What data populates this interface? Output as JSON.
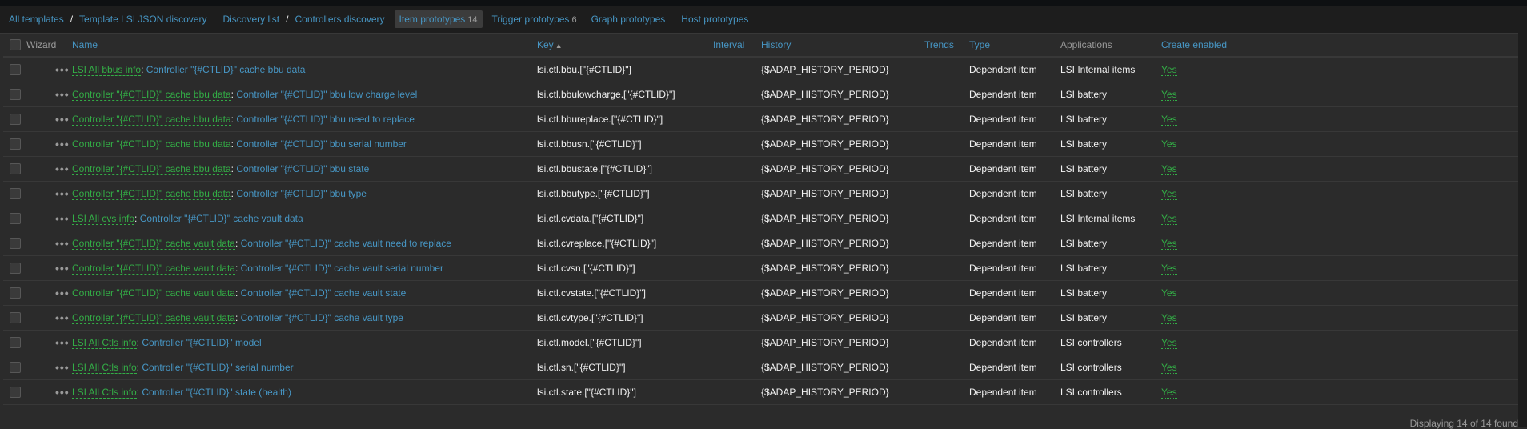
{
  "breadcrumb": {
    "all_templates": "All templates",
    "template": "Template LSI JSON discovery",
    "discovery_list": "Discovery list",
    "discovery_rule": "Controllers discovery"
  },
  "tabs": [
    {
      "label": "Item prototypes",
      "count": "14",
      "active": true
    },
    {
      "label": "Trigger prototypes",
      "count": "6",
      "active": false
    },
    {
      "label": "Graph prototypes",
      "count": "",
      "active": false
    },
    {
      "label": "Host prototypes",
      "count": "",
      "active": false
    }
  ],
  "table": {
    "headers": {
      "wizard": "Wizard",
      "name": "Name",
      "key": "Key",
      "interval": "Interval",
      "history": "History",
      "trends": "Trends",
      "type": "Type",
      "applications": "Applications",
      "create_enabled": "Create enabled"
    },
    "sort_indicator": "▲",
    "rows": [
      {
        "master": "LSI All bbus info",
        "name": "Controller \"{#CTLID}\" cache bbu data",
        "key": "lsi.ctl.bbu.[\"{#CTLID}\"]",
        "interval": "",
        "history": "{$ADAP_HISTORY_PERIOD}",
        "trends": "",
        "type": "Dependent item",
        "app": "LSI Internal items",
        "enabled": "Yes"
      },
      {
        "master": "Controller \"{#CTLID}\" cache bbu data",
        "name": "Controller \"{#CTLID}\" bbu low charge level",
        "key": "lsi.ctl.bbulowcharge.[\"{#CTLID}\"]",
        "interval": "",
        "history": "{$ADAP_HISTORY_PERIOD}",
        "trends": "",
        "type": "Dependent item",
        "app": "LSI battery",
        "enabled": "Yes"
      },
      {
        "master": "Controller \"{#CTLID}\" cache bbu data",
        "name": "Controller \"{#CTLID}\" bbu need to replace",
        "key": "lsi.ctl.bbureplace.[\"{#CTLID}\"]",
        "interval": "",
        "history": "{$ADAP_HISTORY_PERIOD}",
        "trends": "",
        "type": "Dependent item",
        "app": "LSI battery",
        "enabled": "Yes"
      },
      {
        "master": "Controller \"{#CTLID}\" cache bbu data",
        "name": "Controller \"{#CTLID}\" bbu serial number",
        "key": "lsi.ctl.bbusn.[\"{#CTLID}\"]",
        "interval": "",
        "history": "{$ADAP_HISTORY_PERIOD}",
        "trends": "",
        "type": "Dependent item",
        "app": "LSI battery",
        "enabled": "Yes"
      },
      {
        "master": "Controller \"{#CTLID}\" cache bbu data",
        "name": "Controller \"{#CTLID}\" bbu state",
        "key": "lsi.ctl.bbustate.[\"{#CTLID}\"]",
        "interval": "",
        "history": "{$ADAP_HISTORY_PERIOD}",
        "trends": "",
        "type": "Dependent item",
        "app": "LSI battery",
        "enabled": "Yes"
      },
      {
        "master": "Controller \"{#CTLID}\" cache bbu data",
        "name": "Controller \"{#CTLID}\" bbu type",
        "key": "lsi.ctl.bbutype.[\"{#CTLID}\"]",
        "interval": "",
        "history": "{$ADAP_HISTORY_PERIOD}",
        "trends": "",
        "type": "Dependent item",
        "app": "LSI battery",
        "enabled": "Yes"
      },
      {
        "master": "LSI All cvs info",
        "name": "Controller \"{#CTLID}\" cache vault data",
        "key": "lsi.ctl.cvdata.[\"{#CTLID}\"]",
        "interval": "",
        "history": "{$ADAP_HISTORY_PERIOD}",
        "trends": "",
        "type": "Dependent item",
        "app": "LSI Internal items",
        "enabled": "Yes"
      },
      {
        "master": "Controller \"{#CTLID}\" cache vault data",
        "name": "Controller \"{#CTLID}\" cache vault need to replace",
        "key": "lsi.ctl.cvreplace.[\"{#CTLID}\"]",
        "interval": "",
        "history": "{$ADAP_HISTORY_PERIOD}",
        "trends": "",
        "type": "Dependent item",
        "app": "LSI battery",
        "enabled": "Yes"
      },
      {
        "master": "Controller \"{#CTLID}\" cache vault data",
        "name": "Controller \"{#CTLID}\" cache vault serial number",
        "key": "lsi.ctl.cvsn.[\"{#CTLID}\"]",
        "interval": "",
        "history": "{$ADAP_HISTORY_PERIOD}",
        "trends": "",
        "type": "Dependent item",
        "app": "LSI battery",
        "enabled": "Yes"
      },
      {
        "master": "Controller \"{#CTLID}\" cache vault data",
        "name": "Controller \"{#CTLID}\" cache vault state",
        "key": "lsi.ctl.cvstate.[\"{#CTLID}\"]",
        "interval": "",
        "history": "{$ADAP_HISTORY_PERIOD}",
        "trends": "",
        "type": "Dependent item",
        "app": "LSI battery",
        "enabled": "Yes"
      },
      {
        "master": "Controller \"{#CTLID}\" cache vault data",
        "name": "Controller \"{#CTLID}\" cache vault type",
        "key": "lsi.ctl.cvtype.[\"{#CTLID}\"]",
        "interval": "",
        "history": "{$ADAP_HISTORY_PERIOD}",
        "trends": "",
        "type": "Dependent item",
        "app": "LSI battery",
        "enabled": "Yes"
      },
      {
        "master": "LSI All Ctls info",
        "name": "Controller \"{#CTLID}\" model",
        "key": "lsi.ctl.model.[\"{#CTLID}\"]",
        "interval": "",
        "history": "{$ADAP_HISTORY_PERIOD}",
        "trends": "",
        "type": "Dependent item",
        "app": "LSI controllers",
        "enabled": "Yes"
      },
      {
        "master": "LSI All Ctls info",
        "name": "Controller \"{#CTLID}\" serial number",
        "key": "lsi.ctl.sn.[\"{#CTLID}\"]",
        "interval": "",
        "history": "{$ADAP_HISTORY_PERIOD}",
        "trends": "",
        "type": "Dependent item",
        "app": "LSI controllers",
        "enabled": "Yes"
      },
      {
        "master": "LSI All Ctls info",
        "name": "Controller \"{#CTLID}\" state (health)",
        "key": "lsi.ctl.state.[\"{#CTLID}\"]",
        "interval": "",
        "history": "{$ADAP_HISTORY_PERIOD}",
        "trends": "",
        "type": "Dependent item",
        "app": "LSI controllers",
        "enabled": "Yes"
      }
    ]
  },
  "footer": {
    "status": "Displaying 14 of 14 found"
  },
  "colors": {
    "link": "#4796c4",
    "enabled": "#33ad46",
    "background": "#2b2b2b",
    "nav": "#1d1d1d"
  }
}
